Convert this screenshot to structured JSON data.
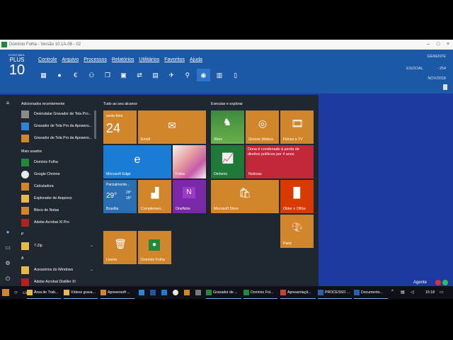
{
  "window": {
    "title": "Domínio Folha - Versão 10.1A-06 - 02"
  },
  "logo": {
    "line1": "CONTÁBIL",
    "line2": "PLUS",
    "line3": "10"
  },
  "menu": [
    "Controle",
    "Arquivo",
    "Processos",
    "Relatórios",
    "Utilitários",
    "Favoritos",
    "Ajuda"
  ],
  "info": {
    "user": "GERENTE",
    "esocial": "ESOCIAL",
    "code": "- 254",
    "date": "NOV/2018"
  },
  "toolbar_icons": [
    "building-icon",
    "person-icon",
    "euro-icon",
    "people-icon",
    "copy-icon",
    "grid-icon",
    "transfer-icon",
    "file-icon",
    "plane-icon",
    "search-icon",
    "user-active-icon",
    "calculator-icon",
    "document-icon"
  ],
  "start": {
    "recent_header": "Adicionados recentemente",
    "recent": [
      {
        "label": "Desinstalar Gravador de Tela Pro...",
        "color": "#8a8a8a"
      },
      {
        "label": "Gravador de Tela Pro da Apowers...",
        "color": "#2f82d6"
      },
      {
        "label": "Gravador de Tela Pro da Apowers...",
        "color": "#d2862b"
      }
    ],
    "most_used_header": "Mais usados",
    "most_used": [
      {
        "label": "Domínio Folha",
        "color": "#1f8a3a"
      },
      {
        "label": "Google Chrome",
        "color": "#e8e8e8"
      },
      {
        "label": "Calculadora",
        "color": "#d2862b"
      },
      {
        "label": "Explorador de Arquivos",
        "color": "#e7b84a"
      },
      {
        "label": "Bloco de Notas",
        "color": "#d2862b"
      },
      {
        "label": "Adobe Acrobat XI Pro",
        "color": "#b42020"
      }
    ],
    "letter_p": "P",
    "letter_a": "A",
    "alpha_items": [
      {
        "label": "7-Zip",
        "color": "#e7b84a",
        "expand": "⌄"
      },
      {
        "label": "Acessórios do Windows",
        "color": "#e7b84a",
        "expand": "⌄"
      },
      {
        "label": "Adobe Acrobat Distiller XI",
        "color": "#b42020",
        "expand": ""
      }
    ],
    "group1": "Tudo ao seu alcance",
    "group2": "Executar e explorar",
    "calendar": {
      "day": "sexta-feira",
      "date": "24"
    },
    "tiles": {
      "email": "Email",
      "edge": "Microsoft Edge",
      "fotos": "Fotos",
      "weather_cond": "Parcialmente...",
      "weather_temp": "29°",
      "weather_hi": "29°",
      "weather_lo": "18°",
      "weather_city": "Brasília",
      "complementos": "Complemen...",
      "onenote": "OneNote",
      "xbox": "Xbox",
      "groove": "Groove Música",
      "filmes": "Filmes e TV",
      "dinheiro": "Dinheiro",
      "noticias_text": "Dona é condenado à perda de direitos políticos por 4 anos",
      "noticias": "Notícias",
      "store": "Microsoft Store",
      "office": "Obter o Office",
      "paint": "Paint",
      "lixeira": "Lixeira",
      "dominio": "Domínio Folha"
    }
  },
  "taskbar": {
    "items": [
      "Área de Trab...",
      "Vídeos grava...",
      "Apowersoft ...",
      "Gravador de ...",
      "Domínio Fol...",
      "Apresentaçã...",
      "PROCESSO ...",
      "Documento..."
    ],
    "time": "15:18"
  },
  "status": {
    "agent": "Agente"
  }
}
